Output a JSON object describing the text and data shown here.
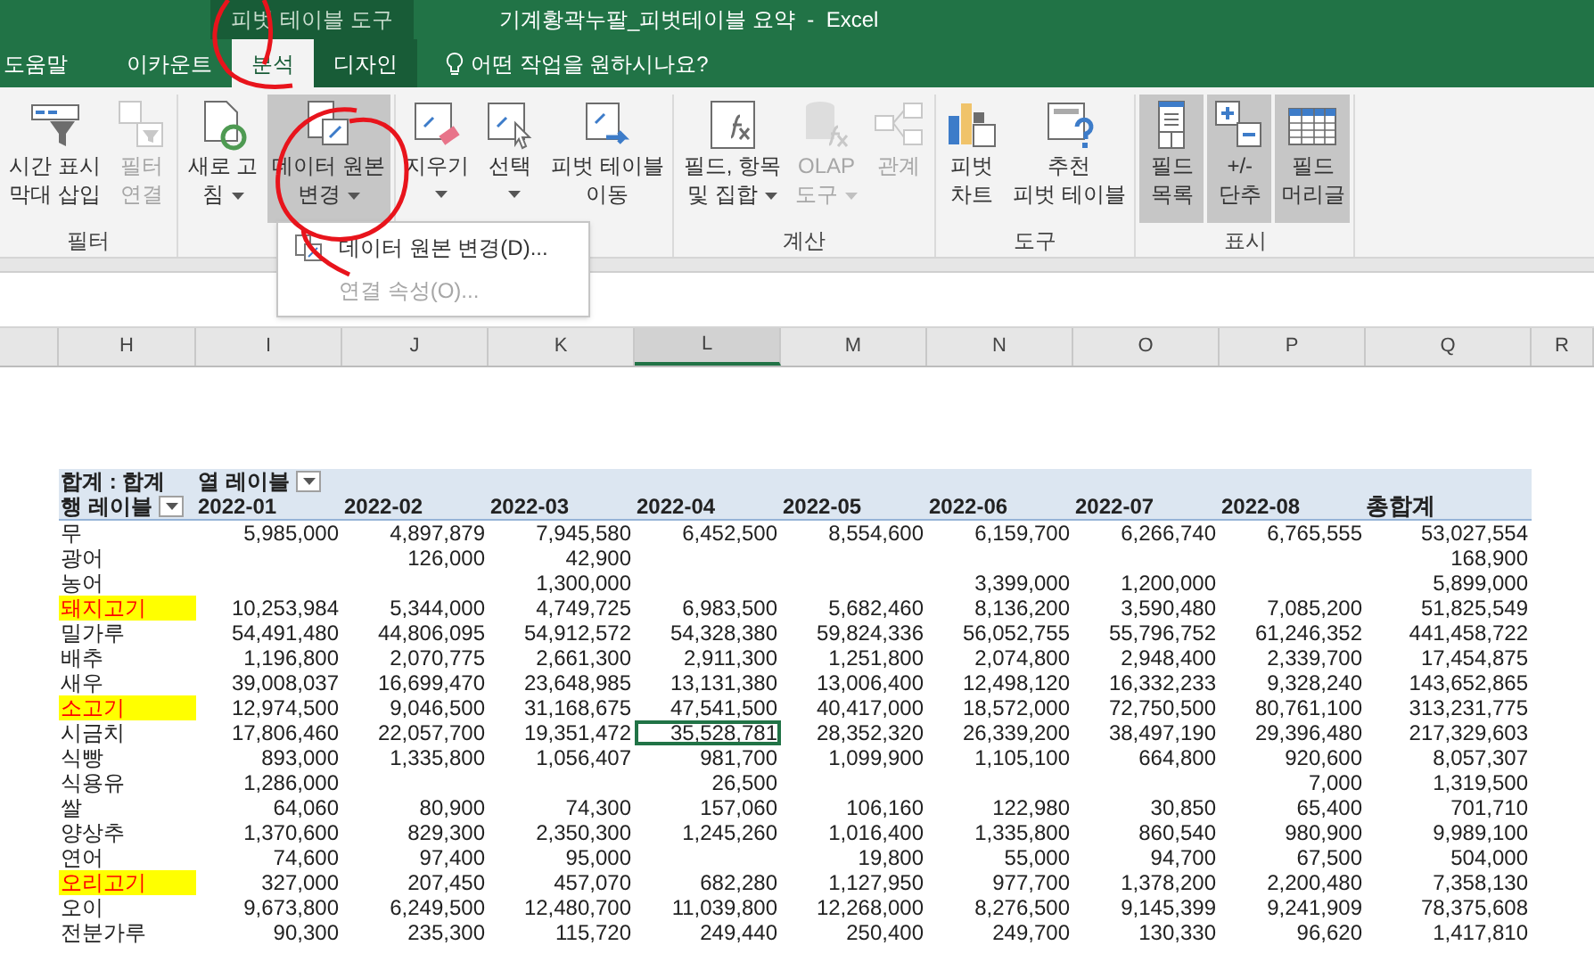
{
  "title_bar": {
    "context_tab": "피벗 테이블 도구",
    "title": "기계황곽누팔_피벗테이블 요약  -  Excel"
  },
  "ribbon_tabs": [
    {
      "label": "도움말",
      "selected": false,
      "contextual": false
    },
    {
      "label": "이카운트",
      "selected": false,
      "contextual": false
    },
    {
      "label": "분석",
      "selected": true,
      "contextual": true
    },
    {
      "label": "디자인",
      "selected": false,
      "contextual": true
    }
  ],
  "tell_me": "어떤 작업을 원하시나요?",
  "ribbon_groups": [
    {
      "label": "필터",
      "buttons": [
        {
          "lines": [
            "시간 표시",
            "막대 삽입"
          ],
          "disabled": false,
          "pressed": false,
          "has_menu": false
        },
        {
          "lines": [
            "필터",
            "연결"
          ],
          "disabled": true,
          "pressed": false,
          "has_menu": false
        }
      ]
    },
    {
      "buttons": [
        {
          "lines": [
            "새로 고",
            "침"
          ],
          "disabled": false,
          "pressed": false,
          "has_menu": true
        },
        {
          "lines": [
            "데이터 원본",
            "변경"
          ],
          "disabled": false,
          "pressed": true,
          "has_menu": true
        }
      ]
    },
    {
      "buttons": [
        {
          "lines": [
            "지우기"
          ],
          "disabled": false,
          "pressed": false,
          "has_menu": true
        },
        {
          "lines": [
            "선택"
          ],
          "disabled": false,
          "pressed": false,
          "has_menu": true
        },
        {
          "lines": [
            "피벗 테이블",
            "이동"
          ],
          "disabled": false,
          "pressed": false,
          "has_menu": false
        }
      ]
    },
    {
      "label": "계산",
      "buttons": [
        {
          "lines": [
            "필드, 항목",
            "및 집합"
          ],
          "disabled": false,
          "pressed": false,
          "has_menu": true
        },
        {
          "lines": [
            "OLAP",
            "도구"
          ],
          "disabled": true,
          "pressed": false,
          "has_menu": true
        },
        {
          "lines": [
            "관계"
          ],
          "disabled": true,
          "pressed": false,
          "has_menu": false
        }
      ]
    },
    {
      "label": "도구",
      "buttons": [
        {
          "lines": [
            "피벗",
            "차트"
          ],
          "disabled": false,
          "pressed": false,
          "has_menu": false
        },
        {
          "lines": [
            "추천",
            "피벗 테이블"
          ],
          "disabled": false,
          "pressed": false,
          "has_menu": false
        }
      ]
    },
    {
      "label": "표시",
      "buttons": [
        {
          "lines": [
            "필드",
            "목록"
          ],
          "disabled": false,
          "pressed": true,
          "has_menu": false
        },
        {
          "lines": [
            "+/-",
            "단추"
          ],
          "disabled": false,
          "pressed": true,
          "has_menu": false
        },
        {
          "lines": [
            "필드",
            "머리글"
          ],
          "disabled": false,
          "pressed": true,
          "has_menu": false
        }
      ]
    }
  ],
  "dropdown_menu": {
    "items": [
      {
        "label": "데이터 원본 변경(D)...",
        "disabled": false
      },
      {
        "label": "연결 속성(O)...",
        "disabled": true
      }
    ]
  },
  "column_headers": [
    {
      "label": "H",
      "selected": false
    },
    {
      "label": "I",
      "selected": false
    },
    {
      "label": "J",
      "selected": false
    },
    {
      "label": "K",
      "selected": false
    },
    {
      "label": "L",
      "selected": true
    },
    {
      "label": "M",
      "selected": false
    },
    {
      "label": "N",
      "selected": false
    },
    {
      "label": "O",
      "selected": false
    },
    {
      "label": "P",
      "selected": false
    },
    {
      "label": "Q",
      "selected": false
    },
    {
      "label": "R",
      "selected": false
    }
  ],
  "pivot": {
    "corner": "합계 : 합계",
    "column_label": "열 레이블",
    "row_label": "행 레이블",
    "months": [
      "2022-01",
      "2022-02",
      "2022-03",
      "2022-04",
      "2022-05",
      "2022-06",
      "2022-07",
      "2022-08"
    ],
    "grand_total": "총합계",
    "rows": [
      {
        "label": "무",
        "highlighted": false,
        "selected": false,
        "cells": [
          {
            "value": "5,985,000"
          },
          {
            "value": "4,897,879"
          },
          {
            "value": "7,945,580"
          },
          {
            "value": "6,452,500"
          },
          {
            "value": "8,554,600"
          },
          {
            "value": "6,159,700"
          },
          {
            "value": "6,266,740"
          },
          {
            "value": "6,765,555"
          },
          {
            "value": "53,027,554"
          }
        ]
      },
      {
        "label": "광어",
        "highlighted": false,
        "selected": false,
        "cells": [
          {},
          {
            "value": "126,000"
          },
          {
            "value": "42,900"
          },
          {},
          {},
          {},
          {},
          {},
          {
            "value": "168,900"
          }
        ]
      },
      {
        "label": "농어",
        "highlighted": false,
        "selected": false,
        "cells": [
          {},
          {},
          {
            "value": "1,300,000"
          },
          {},
          {},
          {
            "value": "3,399,000"
          },
          {
            "value": "1,200,000"
          },
          {},
          {
            "value": "5,899,000"
          }
        ]
      },
      {
        "label": "돼지고기",
        "highlighted": true,
        "selected": false,
        "cells": [
          {
            "value": "10,253,984"
          },
          {
            "value": "5,344,000"
          },
          {
            "value": "4,749,725"
          },
          {
            "value": "6,983,500"
          },
          {
            "value": "5,682,460"
          },
          {
            "value": "8,136,200"
          },
          {
            "value": "3,590,480"
          },
          {
            "value": "7,085,200"
          },
          {
            "value": "51,825,549"
          }
        ]
      },
      {
        "label": "밀가루",
        "highlighted": false,
        "selected": false,
        "cells": [
          {
            "value": "54,491,480"
          },
          {
            "value": "44,806,095"
          },
          {
            "value": "54,912,572"
          },
          {
            "value": "54,328,380"
          },
          {
            "value": "59,824,336"
          },
          {
            "value": "56,052,755"
          },
          {
            "value": "55,796,752"
          },
          {
            "value": "61,246,352"
          },
          {
            "value": "441,458,722"
          }
        ]
      },
      {
        "label": "배추",
        "highlighted": false,
        "selected": false,
        "cells": [
          {
            "value": "1,196,800"
          },
          {
            "value": "2,070,775"
          },
          {
            "value": "2,661,300"
          },
          {
            "value": "2,911,300"
          },
          {
            "value": "1,251,800"
          },
          {
            "value": "2,074,800"
          },
          {
            "value": "2,948,400"
          },
          {
            "value": "2,339,700"
          },
          {
            "value": "17,454,875"
          }
        ]
      },
      {
        "label": "새우",
        "highlighted": false,
        "selected": false,
        "cells": [
          {
            "value": "39,008,037"
          },
          {
            "value": "16,699,470"
          },
          {
            "value": "23,648,985"
          },
          {
            "value": "13,131,380"
          },
          {
            "value": "13,006,400"
          },
          {
            "value": "12,498,120"
          },
          {
            "value": "16,332,233"
          },
          {
            "value": "9,328,240"
          },
          {
            "value": "143,652,865"
          }
        ]
      },
      {
        "label": "소고기",
        "highlighted": true,
        "selected": false,
        "cells": [
          {
            "value": "12,974,500"
          },
          {
            "value": "9,046,500"
          },
          {
            "value": "31,168,675"
          },
          {
            "value": "47,541,500"
          },
          {
            "value": "40,417,000"
          },
          {
            "value": "18,572,000"
          },
          {
            "value": "72,750,500"
          },
          {
            "value": "80,761,100"
          },
          {
            "value": "313,231,775"
          }
        ]
      },
      {
        "label": "시금치",
        "highlighted": false,
        "selected": true,
        "cells": [
          {
            "value": "17,806,460"
          },
          {
            "value": "22,057,700"
          },
          {
            "value": "19,351,472"
          },
          {
            "value": "35,528,781"
          },
          {
            "value": "28,352,320"
          },
          {
            "value": "26,339,200"
          },
          {
            "value": "38,497,190"
          },
          {
            "value": "29,396,480"
          },
          {
            "value": "217,329,603"
          }
        ]
      },
      {
        "label": "식빵",
        "highlighted": false,
        "selected": false,
        "cells": [
          {
            "value": "893,000"
          },
          {
            "value": "1,335,800"
          },
          {
            "value": "1,056,407"
          },
          {
            "value": "981,700"
          },
          {
            "value": "1,099,900"
          },
          {
            "value": "1,105,100"
          },
          {
            "value": "664,800"
          },
          {
            "value": "920,600"
          },
          {
            "value": "8,057,307"
          }
        ]
      },
      {
        "label": "식용유",
        "highlighted": false,
        "selected": false,
        "cells": [
          {
            "value": "1,286,000"
          },
          {},
          {},
          {
            "value": "26,500"
          },
          {},
          {},
          {},
          {
            "value": "7,000"
          },
          {
            "value": "1,319,500"
          }
        ]
      },
      {
        "label": "쌀",
        "highlighted": false,
        "selected": false,
        "cells": [
          {
            "value": "64,060"
          },
          {
            "value": "80,900"
          },
          {
            "value": "74,300"
          },
          {
            "value": "157,060"
          },
          {
            "value": "106,160"
          },
          {
            "value": "122,980"
          },
          {
            "value": "30,850"
          },
          {
            "value": "65,400"
          },
          {
            "value": "701,710"
          }
        ]
      },
      {
        "label": "양상추",
        "highlighted": false,
        "selected": false,
        "cells": [
          {
            "value": "1,370,600"
          },
          {
            "value": "829,300"
          },
          {
            "value": "2,350,300"
          },
          {
            "value": "1,245,260"
          },
          {
            "value": "1,016,400"
          },
          {
            "value": "1,335,800"
          },
          {
            "value": "860,540"
          },
          {
            "value": "980,900"
          },
          {
            "value": "9,989,100"
          }
        ]
      },
      {
        "label": "연어",
        "highlighted": false,
        "selected": false,
        "cells": [
          {
            "value": "74,600"
          },
          {
            "value": "97,400"
          },
          {
            "value": "95,000"
          },
          {},
          {
            "value": "19,800"
          },
          {
            "value": "55,000"
          },
          {
            "value": "94,700"
          },
          {
            "value": "67,500"
          },
          {
            "value": "504,000"
          }
        ]
      },
      {
        "label": "오리고기",
        "highlighted": true,
        "selected": false,
        "cells": [
          {
            "value": "327,000"
          },
          {
            "value": "207,450"
          },
          {
            "value": "457,070"
          },
          {
            "value": "682,280"
          },
          {
            "value": "1,127,950"
          },
          {
            "value": "977,700"
          },
          {
            "value": "1,378,200"
          },
          {
            "value": "2,200,480"
          },
          {
            "value": "7,358,130"
          }
        ]
      },
      {
        "label": "오이",
        "highlighted": false,
        "selected": false,
        "cells": [
          {
            "value": "9,673,800"
          },
          {
            "value": "6,249,500"
          },
          {
            "value": "12,480,700"
          },
          {
            "value": "11,039,800"
          },
          {
            "value": "12,268,000"
          },
          {
            "value": "8,276,500"
          },
          {
            "value": "9,145,399"
          },
          {
            "value": "9,241,909"
          },
          {
            "value": "78,375,608"
          }
        ]
      },
      {
        "label": "전분가루",
        "highlighted": false,
        "selected": false,
        "cells": [
          {
            "value": "90,300"
          },
          {
            "value": "235,300"
          },
          {
            "value": "115,720"
          },
          {
            "value": "249,440"
          },
          {
            "value": "250,400"
          },
          {
            "value": "249,700"
          },
          {
            "value": "130,330"
          },
          {
            "value": "96,620"
          },
          {
            "value": "1,417,810"
          }
        ]
      }
    ]
  }
}
